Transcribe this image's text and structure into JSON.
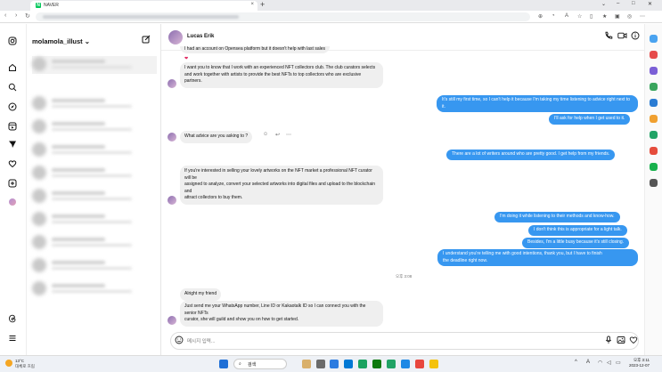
{
  "browser": {
    "tab_title": "NAVER",
    "tab_favicon": "N",
    "tab_close": "×",
    "new_tab": "+"
  },
  "sidebar": {
    "username": "molamola_illust"
  },
  "chat": {
    "contact_name": "Lucas Erik",
    "messages_in_1_partial": "I had an account on Opensea platform but it doesn't help with last sales",
    "msg_in_1": "I want you to know that I work with an experienced NFT collectors club. The club curators selects and work together with artists to provide the best NFTs to top collectors who are exclusive partners.",
    "msg_out_1": "It's still my first time, so I can't help it because I'm taking my time listening to advice right next to it.",
    "msg_out_2": "I'll ask for help when I get used to it.",
    "msg_in_2": "What advice are you asking to ?",
    "msg_out_3": "There are a lot of writers around who are pretty good. I get help from my friends.",
    "msg_in_3_a": "If you're interested in selling your lovely artworks on the NFT market a professional NFT curator will be",
    "msg_in_3_b": "assigned to analyze, convert your selected artworks into digital files and upload to the blockchain and",
    "msg_in_3_c": "attract collectors to buy them.",
    "msg_out_4": "I'm doing it while listening to their methods and know-how.",
    "msg_out_5": "I don't think this is appropriate for a light talk.",
    "msg_out_6": "Besides, I'm a little busy because it's still closing.",
    "msg_out_7_a": "I understand you're telling me with good intentions, thank you, but I have to finish",
    "msg_out_7_b": "the deadline right now.",
    "timestamp": "오후 3:08",
    "msg_in_4": "Alright my friend",
    "msg_in_5_a": "Just send me your WhatsApp number, Line ID or Kakaotalk ID so I can connect you with the senior NFTs",
    "msg_in_5_b": "curator, she will guild and show you on how to get started.",
    "composer_placeholder": "메시지 입력..."
  },
  "taskbar": {
    "temp": "13°C",
    "weather_desc": "대체로 흐림",
    "search_label": "검색",
    "time": "오후 3:11",
    "date": "2023-12-07"
  },
  "colors": {
    "accent_blue": "#3797f0",
    "incoming_bubble": "#efefef"
  },
  "icons": [
    "instagram-icon",
    "home-icon",
    "search-icon",
    "explore-icon",
    "reels-icon",
    "messenger-icon",
    "heart-icon",
    "create-icon",
    "threads-icon",
    "menu-icon",
    "compose-icon",
    "phone-icon",
    "video-icon",
    "info-icon",
    "emoji-icon",
    "mic-icon",
    "image-icon"
  ]
}
